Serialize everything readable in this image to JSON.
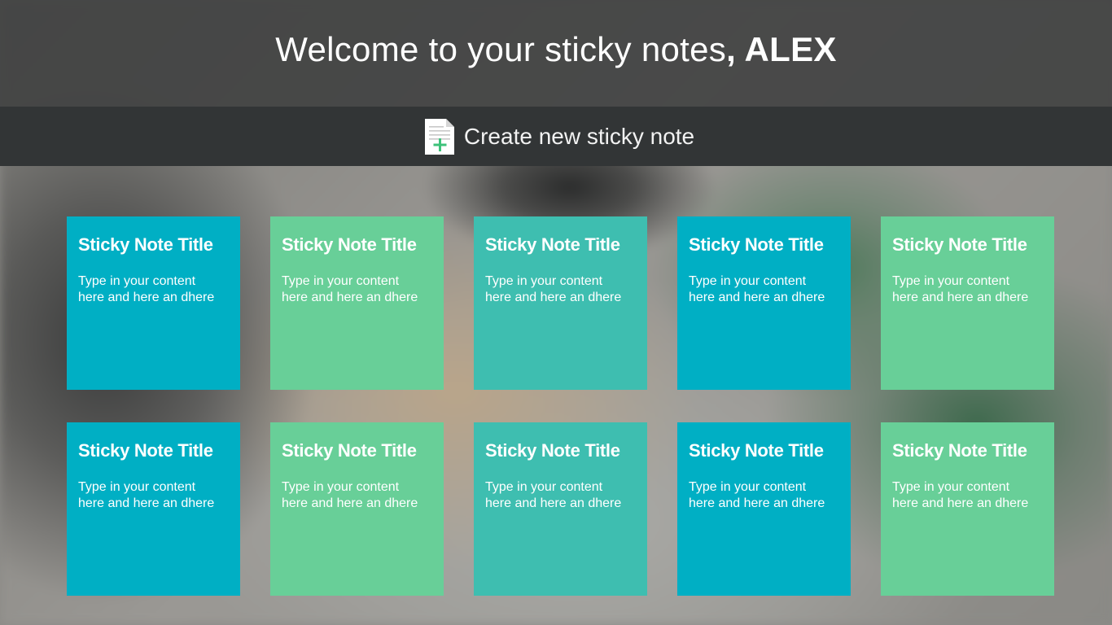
{
  "header": {
    "welcome_prefix": "Welcome to your sticky notes",
    "welcome_name": ", ALEX"
  },
  "create": {
    "label": "Create new sticky note",
    "icon": "new-document-icon"
  },
  "colors": {
    "blue": "#00afc4",
    "green": "#68cf98",
    "teal": "#3ebeb0",
    "header_bg": "#3e3f3f",
    "create_bar_bg": "#323536",
    "icon_plus": "#3ec27a"
  },
  "notes": [
    {
      "title": "Sticky Note Title",
      "content": "Type in your content here and here an dhere",
      "color": "#00afc4"
    },
    {
      "title": "Sticky Note Title",
      "content": "Type in your content here and here an dhere",
      "color": "#68cf98"
    },
    {
      "title": "Sticky Note Title",
      "content": "Type in your content here and here an dhere",
      "color": "#3ebeb0"
    },
    {
      "title": "Sticky Note Title",
      "content": "Type in your content here and here an dhere",
      "color": "#00afc4"
    },
    {
      "title": "Sticky Note Title",
      "content": "Type in your content here and here an dhere",
      "color": "#68cf98"
    },
    {
      "title": "Sticky Note Title",
      "content": "Type in your content here and here an dhere",
      "color": "#00afc4"
    },
    {
      "title": "Sticky Note Title",
      "content": "Type in your content here and here an dhere",
      "color": "#68cf98"
    },
    {
      "title": "Sticky Note Title",
      "content": "Type in your content here and here an dhere",
      "color": "#3ebeb0"
    },
    {
      "title": "Sticky Note Title",
      "content": "Type in your content here and here an dhere",
      "color": "#00afc4"
    },
    {
      "title": "Sticky Note Title",
      "content": "Type in your content here and here an dhere",
      "color": "#68cf98"
    }
  ]
}
